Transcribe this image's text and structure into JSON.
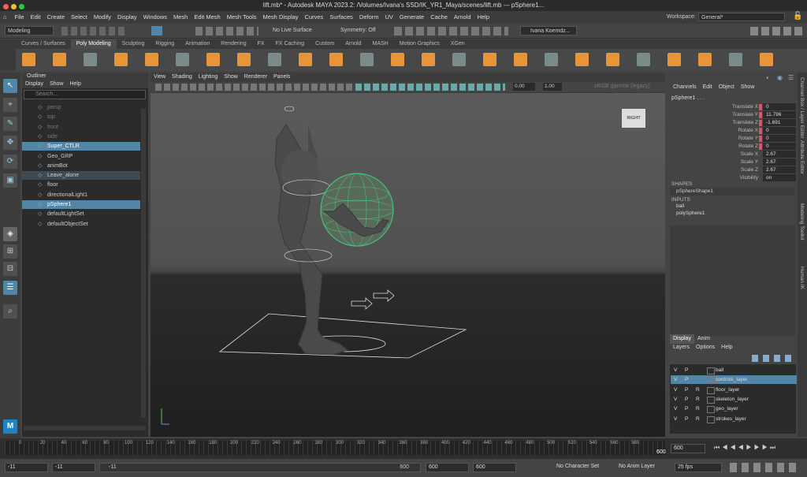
{
  "window": {
    "title": "lift.mb* - Autodesk MAYA 2023.2: /Volumes/Ivana's SSD/IK_YR1_Maya/scenes/lift.mb  ---  pSphere1...",
    "traffic_lights": [
      "#ff5f57",
      "#febc2e",
      "#28c840"
    ]
  },
  "menubar": {
    "items": [
      "File",
      "Edit",
      "Create",
      "Select",
      "Modify",
      "Display",
      "Windows",
      "Mesh",
      "Edit Mesh",
      "Mesh Tools",
      "Mesh Display",
      "Curves",
      "Surfaces",
      "Deform",
      "UV",
      "Generate",
      "Cache",
      "Arnold",
      "Help"
    ],
    "workspace_label": "Workspace:",
    "workspace_value": "General*"
  },
  "statusline": {
    "mode": "Modeling",
    "live_surface": "No Live Surface",
    "symmetry": "Symmetry: Off",
    "user": "Ivana Koemdz..."
  },
  "shelf": {
    "tabs": [
      "Curves / Surfaces",
      "Poly Modeling",
      "Sculpting",
      "Rigging",
      "Animation",
      "Rendering",
      "FX",
      "FX Caching",
      "Custom",
      "Arnold",
      "MASH",
      "Motion Graphics",
      "XGen"
    ],
    "active_tab": 1
  },
  "outliner": {
    "title": "Outliner",
    "menu": [
      "Display",
      "Show",
      "Help"
    ],
    "search_placeholder": "Search...",
    "items": [
      {
        "name": "persp",
        "state": "dim"
      },
      {
        "name": "top",
        "state": "dim"
      },
      {
        "name": "front",
        "state": "dim"
      },
      {
        "name": "side",
        "state": "dim"
      },
      {
        "name": "Super_CTLR",
        "state": "selected"
      },
      {
        "name": "Geo_GRP",
        "state": "normal"
      },
      {
        "name": "animBot",
        "state": "normal"
      },
      {
        "name": "Leave_alone",
        "state": "highlight"
      },
      {
        "name": "floor",
        "state": "normal"
      },
      {
        "name": "directionalLight1",
        "state": "normal"
      },
      {
        "name": "pSphere1",
        "state": "selected"
      },
      {
        "name": "defaultLightSet",
        "state": "normal"
      },
      {
        "name": "defaultObjectSet",
        "state": "normal"
      }
    ]
  },
  "viewport": {
    "menu": [
      "View",
      "Shading",
      "Lighting",
      "Show",
      "Renderer",
      "Panels"
    ],
    "exposure": "0.00",
    "gamma": "1.00",
    "colorspace": "sRGB gamma (legacy)",
    "viewcube_label": "RIGHT"
  },
  "channelbox": {
    "menu": [
      "Channels",
      "Edit",
      "Object",
      "Show"
    ],
    "object_name": "pSphere1 . . .",
    "attributes": [
      {
        "label": "Translate X",
        "value": "0",
        "keyed": true
      },
      {
        "label": "Translate Y",
        "value": "11.796",
        "keyed": true
      },
      {
        "label": "Translate Z",
        "value": "-1.691",
        "keyed": true
      },
      {
        "label": "Rotate X",
        "value": "0",
        "keyed": true
      },
      {
        "label": "Rotate Y",
        "value": "0",
        "keyed": true
      },
      {
        "label": "Rotate Z",
        "value": "0",
        "keyed": true
      },
      {
        "label": "Scale X",
        "value": "2.67",
        "keyed": false
      },
      {
        "label": "Scale Y",
        "value": "2.67",
        "keyed": false
      },
      {
        "label": "Scale Z",
        "value": "2.67",
        "keyed": false
      },
      {
        "label": "Visibility",
        "value": "on",
        "keyed": false
      }
    ],
    "shapes_header": "SHAPES",
    "shape": "pSphereShape1",
    "inputs_header": "INPUTS",
    "inputs": [
      "ball",
      "polySphere1"
    ]
  },
  "side_tabs": [
    "Channel Box / Layer Editor",
    "Attribute Editor",
    "Modeling Toolkit",
    "Human IK"
  ],
  "layers": {
    "tabs": [
      "Display",
      "Anim"
    ],
    "menu": [
      "Layers",
      "Options",
      "Help"
    ],
    "items": [
      {
        "v": "V",
        "p": "P",
        "r": "",
        "name": "ball",
        "selected": false
      },
      {
        "v": "V",
        "p": "P",
        "r": "",
        "name": "controls_layer",
        "selected": true
      },
      {
        "v": "V",
        "p": "P",
        "r": "R",
        "name": "floor_layer",
        "selected": false
      },
      {
        "v": "V",
        "p": "P",
        "r": "R",
        "name": "skeleton_layer",
        "selected": false
      },
      {
        "v": "V",
        "p": "P",
        "r": "R",
        "name": "geo_layer",
        "selected": false
      },
      {
        "v": "V",
        "p": "P",
        "r": "R",
        "name": "strokes_layer",
        "selected": false
      }
    ]
  },
  "timeline": {
    "ticks": [
      "0",
      "20",
      "40",
      "60",
      "80",
      "100",
      "120",
      "140",
      "160",
      "180",
      "200",
      "220",
      "240",
      "260",
      "280",
      "300",
      "320",
      "340",
      "360",
      "380",
      "400",
      "420",
      "440",
      "460",
      "480",
      "500",
      "520",
      "540",
      "560",
      "580"
    ],
    "end_frame_label": "600",
    "current_frame": "600"
  },
  "rangebar": {
    "start": "-11",
    "anim_start": "-11",
    "slider_start": "-11",
    "slider_end": "600",
    "anim_end": "600",
    "end": "600",
    "fps": "25 fps",
    "character_set": "No Character Set",
    "anim_layer": "No Anim Layer"
  },
  "colors": {
    "selection": "#5285a6",
    "keyed": "#d1586b",
    "shelf_accent": "#e8953a"
  }
}
